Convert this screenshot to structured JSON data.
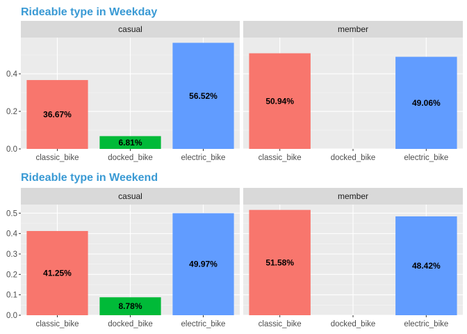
{
  "colors": {
    "classic_bike": "#F8766D",
    "docked_bike": "#00BA38",
    "electric_bike": "#619CFF",
    "title": "#3A9AD4",
    "panel_bg": "#EBEBEB",
    "strip_bg": "#D9D9D9",
    "grid_major": "#FFFFFF"
  },
  "chart_data": [
    {
      "type": "bar",
      "title": "Rideable type in Weekday",
      "categories": [
        "classic_bike",
        "docked_bike",
        "electric_bike"
      ],
      "ylim": [
        0,
        0.593
      ],
      "yticks": [
        0.0,
        0.2,
        0.4
      ],
      "ytick_labels": [
        "0.0",
        "0.2",
        "0.4"
      ],
      "grid": true,
      "facets": [
        {
          "label": "casual",
          "values": [
            0.3667,
            0.0681,
            0.5652
          ],
          "labels": [
            "36.67%",
            "6.81%",
            "56.52%"
          ]
        },
        {
          "label": "member",
          "values": [
            0.5094,
            0,
            0.4906
          ],
          "labels": [
            "50.94%",
            "",
            "49.06%"
          ]
        }
      ]
    },
    {
      "type": "bar",
      "title": "Rideable type in Weekend",
      "categories": [
        "classic_bike",
        "docked_bike",
        "electric_bike"
      ],
      "ylim": [
        0,
        0.542
      ],
      "yticks": [
        0.0,
        0.1,
        0.2,
        0.3,
        0.4,
        0.5
      ],
      "ytick_labels": [
        "0.0",
        "0.1",
        "0.2",
        "0.3",
        "0.4",
        "0.5"
      ],
      "grid": true,
      "facets": [
        {
          "label": "casual",
          "values": [
            0.4125,
            0.0878,
            0.4997
          ],
          "labels": [
            "41.25%",
            "8.78%",
            "49.97%"
          ]
        },
        {
          "label": "member",
          "values": [
            0.5158,
            0,
            0.4842
          ],
          "labels": [
            "51.58%",
            "",
            "48.42%"
          ]
        }
      ]
    }
  ]
}
